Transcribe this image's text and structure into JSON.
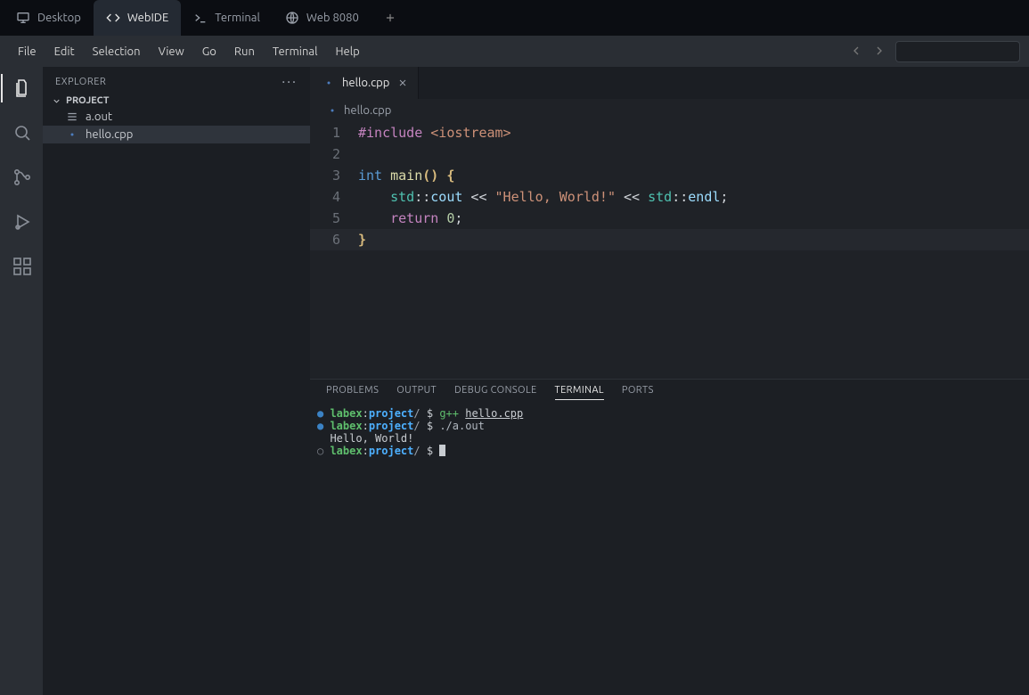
{
  "envtabs": {
    "items": [
      {
        "label": "Desktop",
        "icon": "desktop"
      },
      {
        "label": "WebIDE",
        "icon": "code"
      },
      {
        "label": "Terminal",
        "icon": "terminal"
      },
      {
        "label": "Web 8080",
        "icon": "globe"
      }
    ],
    "active_index": 1
  },
  "menubar": {
    "items": [
      "File",
      "Edit",
      "Selection",
      "View",
      "Go",
      "Run",
      "Terminal",
      "Help"
    ]
  },
  "activitybar": {
    "items": [
      "explorer",
      "search",
      "git",
      "debug",
      "extensions"
    ],
    "active_index": 0
  },
  "sidebar": {
    "title": "EXPLORER",
    "project_label": "PROJECT",
    "tree": [
      {
        "name": "a.out",
        "icon": "binary",
        "selected": false
      },
      {
        "name": "hello.cpp",
        "icon": "cpp",
        "selected": true
      }
    ]
  },
  "editor": {
    "tab_label": "hello.cpp",
    "breadcrumb": "hello.cpp",
    "current_line": 6,
    "lines": [
      {
        "n": 1,
        "tokens": [
          [
            "tk-prep",
            "#include"
          ],
          [
            "tk-pun",
            " "
          ],
          [
            "tk-inc",
            "<iostream>"
          ]
        ]
      },
      {
        "n": 2,
        "tokens": []
      },
      {
        "n": 3,
        "tokens": [
          [
            "tk-kw",
            "int"
          ],
          [
            "tk-pun",
            " "
          ],
          [
            "tk-fn",
            "main"
          ],
          [
            "tk-par",
            "()"
          ],
          [
            "tk-pun",
            " "
          ],
          [
            "tk-br",
            "{"
          ]
        ]
      },
      {
        "n": 4,
        "tokens": [
          [
            "tk-pun",
            "    "
          ],
          [
            "tk-ns",
            "std"
          ],
          [
            "tk-pun",
            "::"
          ],
          [
            "tk-var",
            "cout"
          ],
          [
            "tk-pun",
            " << "
          ],
          [
            "tk-str",
            "\"Hello, World!\""
          ],
          [
            "tk-pun",
            " << "
          ],
          [
            "tk-ns",
            "std"
          ],
          [
            "tk-pun",
            "::"
          ],
          [
            "tk-var",
            "endl"
          ],
          [
            "tk-pun",
            ";"
          ]
        ]
      },
      {
        "n": 5,
        "tokens": [
          [
            "tk-pun",
            "    "
          ],
          [
            "tk-flow",
            "return"
          ],
          [
            "tk-pun",
            " "
          ],
          [
            "tk-num",
            "0"
          ],
          [
            "tk-pun",
            ";"
          ]
        ]
      },
      {
        "n": 6,
        "tokens": [
          [
            "tk-br",
            "}"
          ]
        ]
      }
    ]
  },
  "panel": {
    "tabs": [
      "PROBLEMS",
      "OUTPUT",
      "DEBUG CONSOLE",
      "TERMINAL",
      "PORTS"
    ],
    "active_index": 3,
    "terminal_lines": [
      {
        "type": "prompt",
        "bullet": "filled",
        "user": "labex",
        "path": "project",
        "cmd": "g++",
        "arg": "hello.cpp",
        "arg_underline": true
      },
      {
        "type": "prompt",
        "bullet": "filled",
        "user": "labex",
        "path": "project",
        "cmd": "./a.out",
        "cmd_style": "exec"
      },
      {
        "type": "output",
        "text": "  Hello, World!"
      },
      {
        "type": "prompt",
        "bullet": "open",
        "user": "labex",
        "path": "project",
        "cursor": true
      }
    ]
  }
}
